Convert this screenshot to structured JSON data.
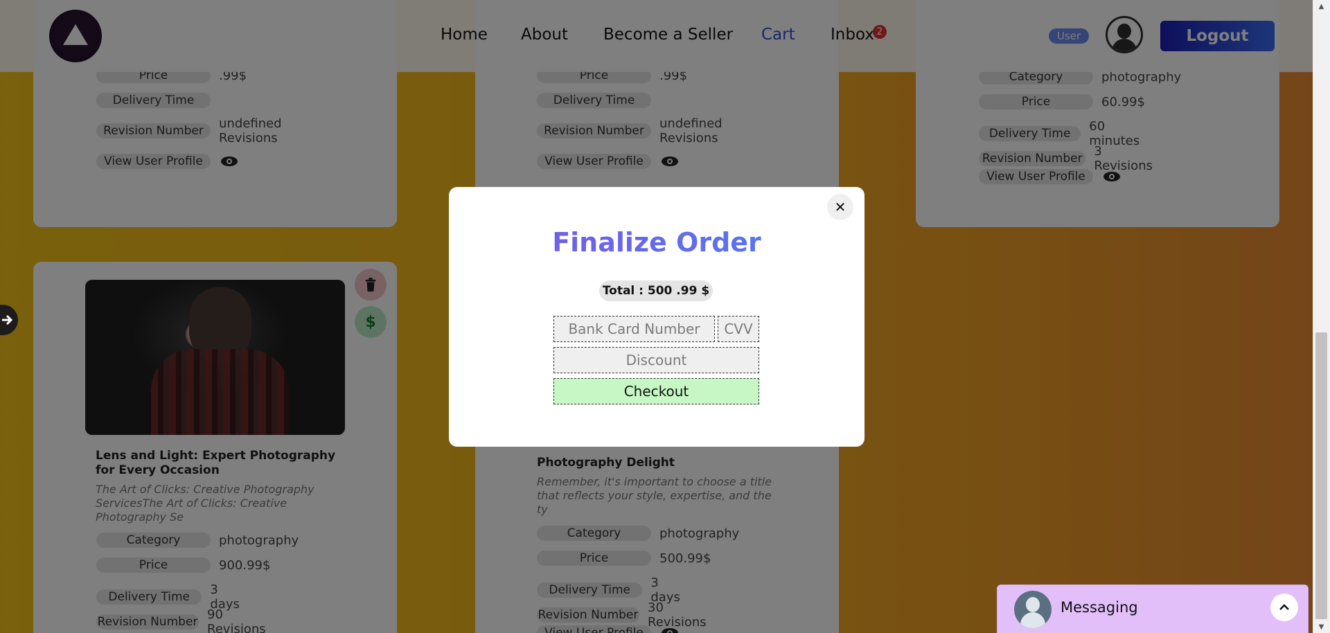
{
  "nav": {
    "links": [
      "Home",
      "About",
      "Become a Seller",
      "Cart",
      "Inbox"
    ],
    "inbox_count": "2",
    "user_badge": "User",
    "logout_label": "Logout",
    "active_link": "Cart",
    "accent_color": "#2d4fd6"
  },
  "labels": {
    "category": "Category",
    "price": "Price",
    "delivery": "Delivery Time",
    "revisions": "Revision Number",
    "view_profile": "View User Profile"
  },
  "cards": [
    {
      "price": ".99$",
      "delivery": "",
      "revisions": "undefined Revisions"
    },
    {
      "price": ".99$",
      "delivery": "",
      "revisions": "undefined Revisions"
    },
    {
      "category": "photography",
      "price": "60.99$",
      "delivery": "60 minutes",
      "revisions": "3 Revisions"
    },
    {
      "title": "Lens and Light: Expert Photography for Every Occasion",
      "description": "The Art of Clicks: Creative Photography ServicesThe Art of Clicks: Creative Photography Se",
      "category": "photography",
      "price": "900.99$",
      "delivery": "3 days",
      "revisions": "90 Revisions"
    },
    {
      "title": "Photography Delight",
      "description": "Remember, it's important to choose a title that reflects your style, expertise, and the ty",
      "category": "photography",
      "price": "500.99$",
      "delivery": "3 days",
      "revisions": "30 Revisions",
      "view_profile": "View User Profile"
    }
  ],
  "modal": {
    "title": "Finalize Order",
    "total": "Total : 500 .99 $",
    "card_placeholder": "Bank Card Number",
    "cvv_placeholder": "CVV",
    "discount_placeholder": "Discount",
    "checkout_label": "Checkout",
    "close_symbol": "✕"
  },
  "messaging": {
    "label": "Messaging"
  }
}
